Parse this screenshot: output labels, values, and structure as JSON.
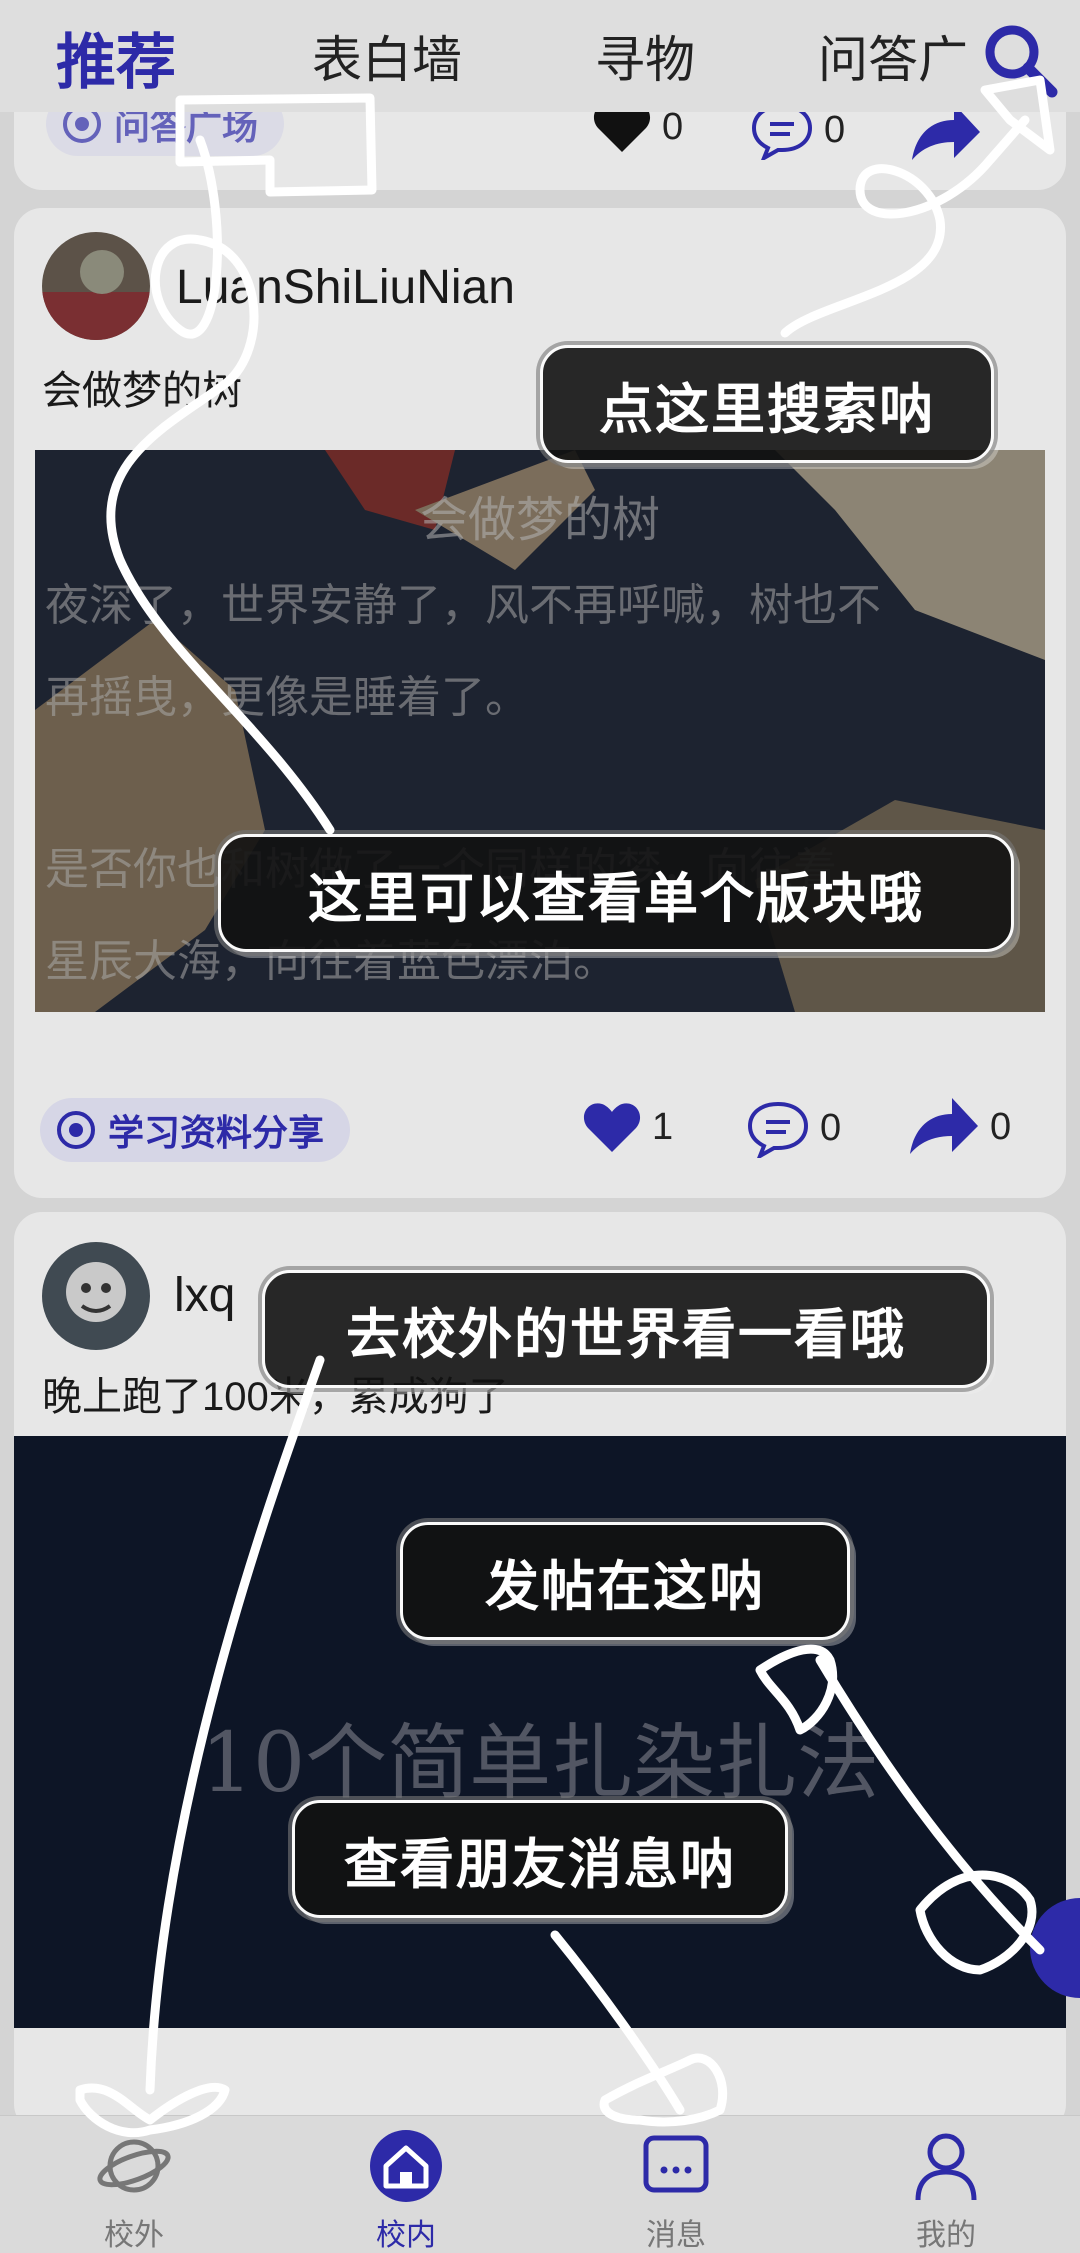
{
  "top_tabs": [
    {
      "label": "推荐",
      "active": true
    },
    {
      "label": "表白墙",
      "active": false
    },
    {
      "label": "寻物",
      "active": false
    },
    {
      "label": "问答广",
      "active": false
    }
  ],
  "icons": {
    "search": "search-icon",
    "like": "heart-icon",
    "comment": "comment-icon",
    "share": "share-icon",
    "tag": "target-icon"
  },
  "cut_card": {
    "tag": "问答广场",
    "likes": "0",
    "comments": "0"
  },
  "post1": {
    "username": "LuanShiLiuNian",
    "text": "会做梦的树",
    "image_title": "会做梦的树",
    "image_lines": [
      "    夜深了，世界安静了，风不再呼喊，树也不",
      "再摇曳，更像是睡着了。",
      "",
      "    是否你也和树做了一个同样的梦，向往着",
      "星辰大海，向往着蓝色漂泊。"
    ],
    "tag": "学习资料分享",
    "likes": "1",
    "comments": "0",
    "shares": "0"
  },
  "post2": {
    "username": "lxq",
    "text": "晚上跑了100米，累成狗了",
    "image_title": "10个简单扎染扎法"
  },
  "tooltips": {
    "search_hint": "点这里搜索呐",
    "section_hint": "这里可以查看单个版块哦",
    "outside_hint": "去校外的世界看一看哦",
    "post_hint": "发帖在这呐",
    "message_hint": "查看朋友消息呐"
  },
  "bottom_nav": [
    {
      "label": "校外",
      "active": false
    },
    {
      "label": "校内",
      "active": true
    },
    {
      "label": "消息",
      "active": false
    },
    {
      "label": "我的",
      "active": false
    }
  ],
  "colors": {
    "accent": "#2d2aa8",
    "background": "#d4d4d4",
    "card": "#e7e7e7"
  }
}
